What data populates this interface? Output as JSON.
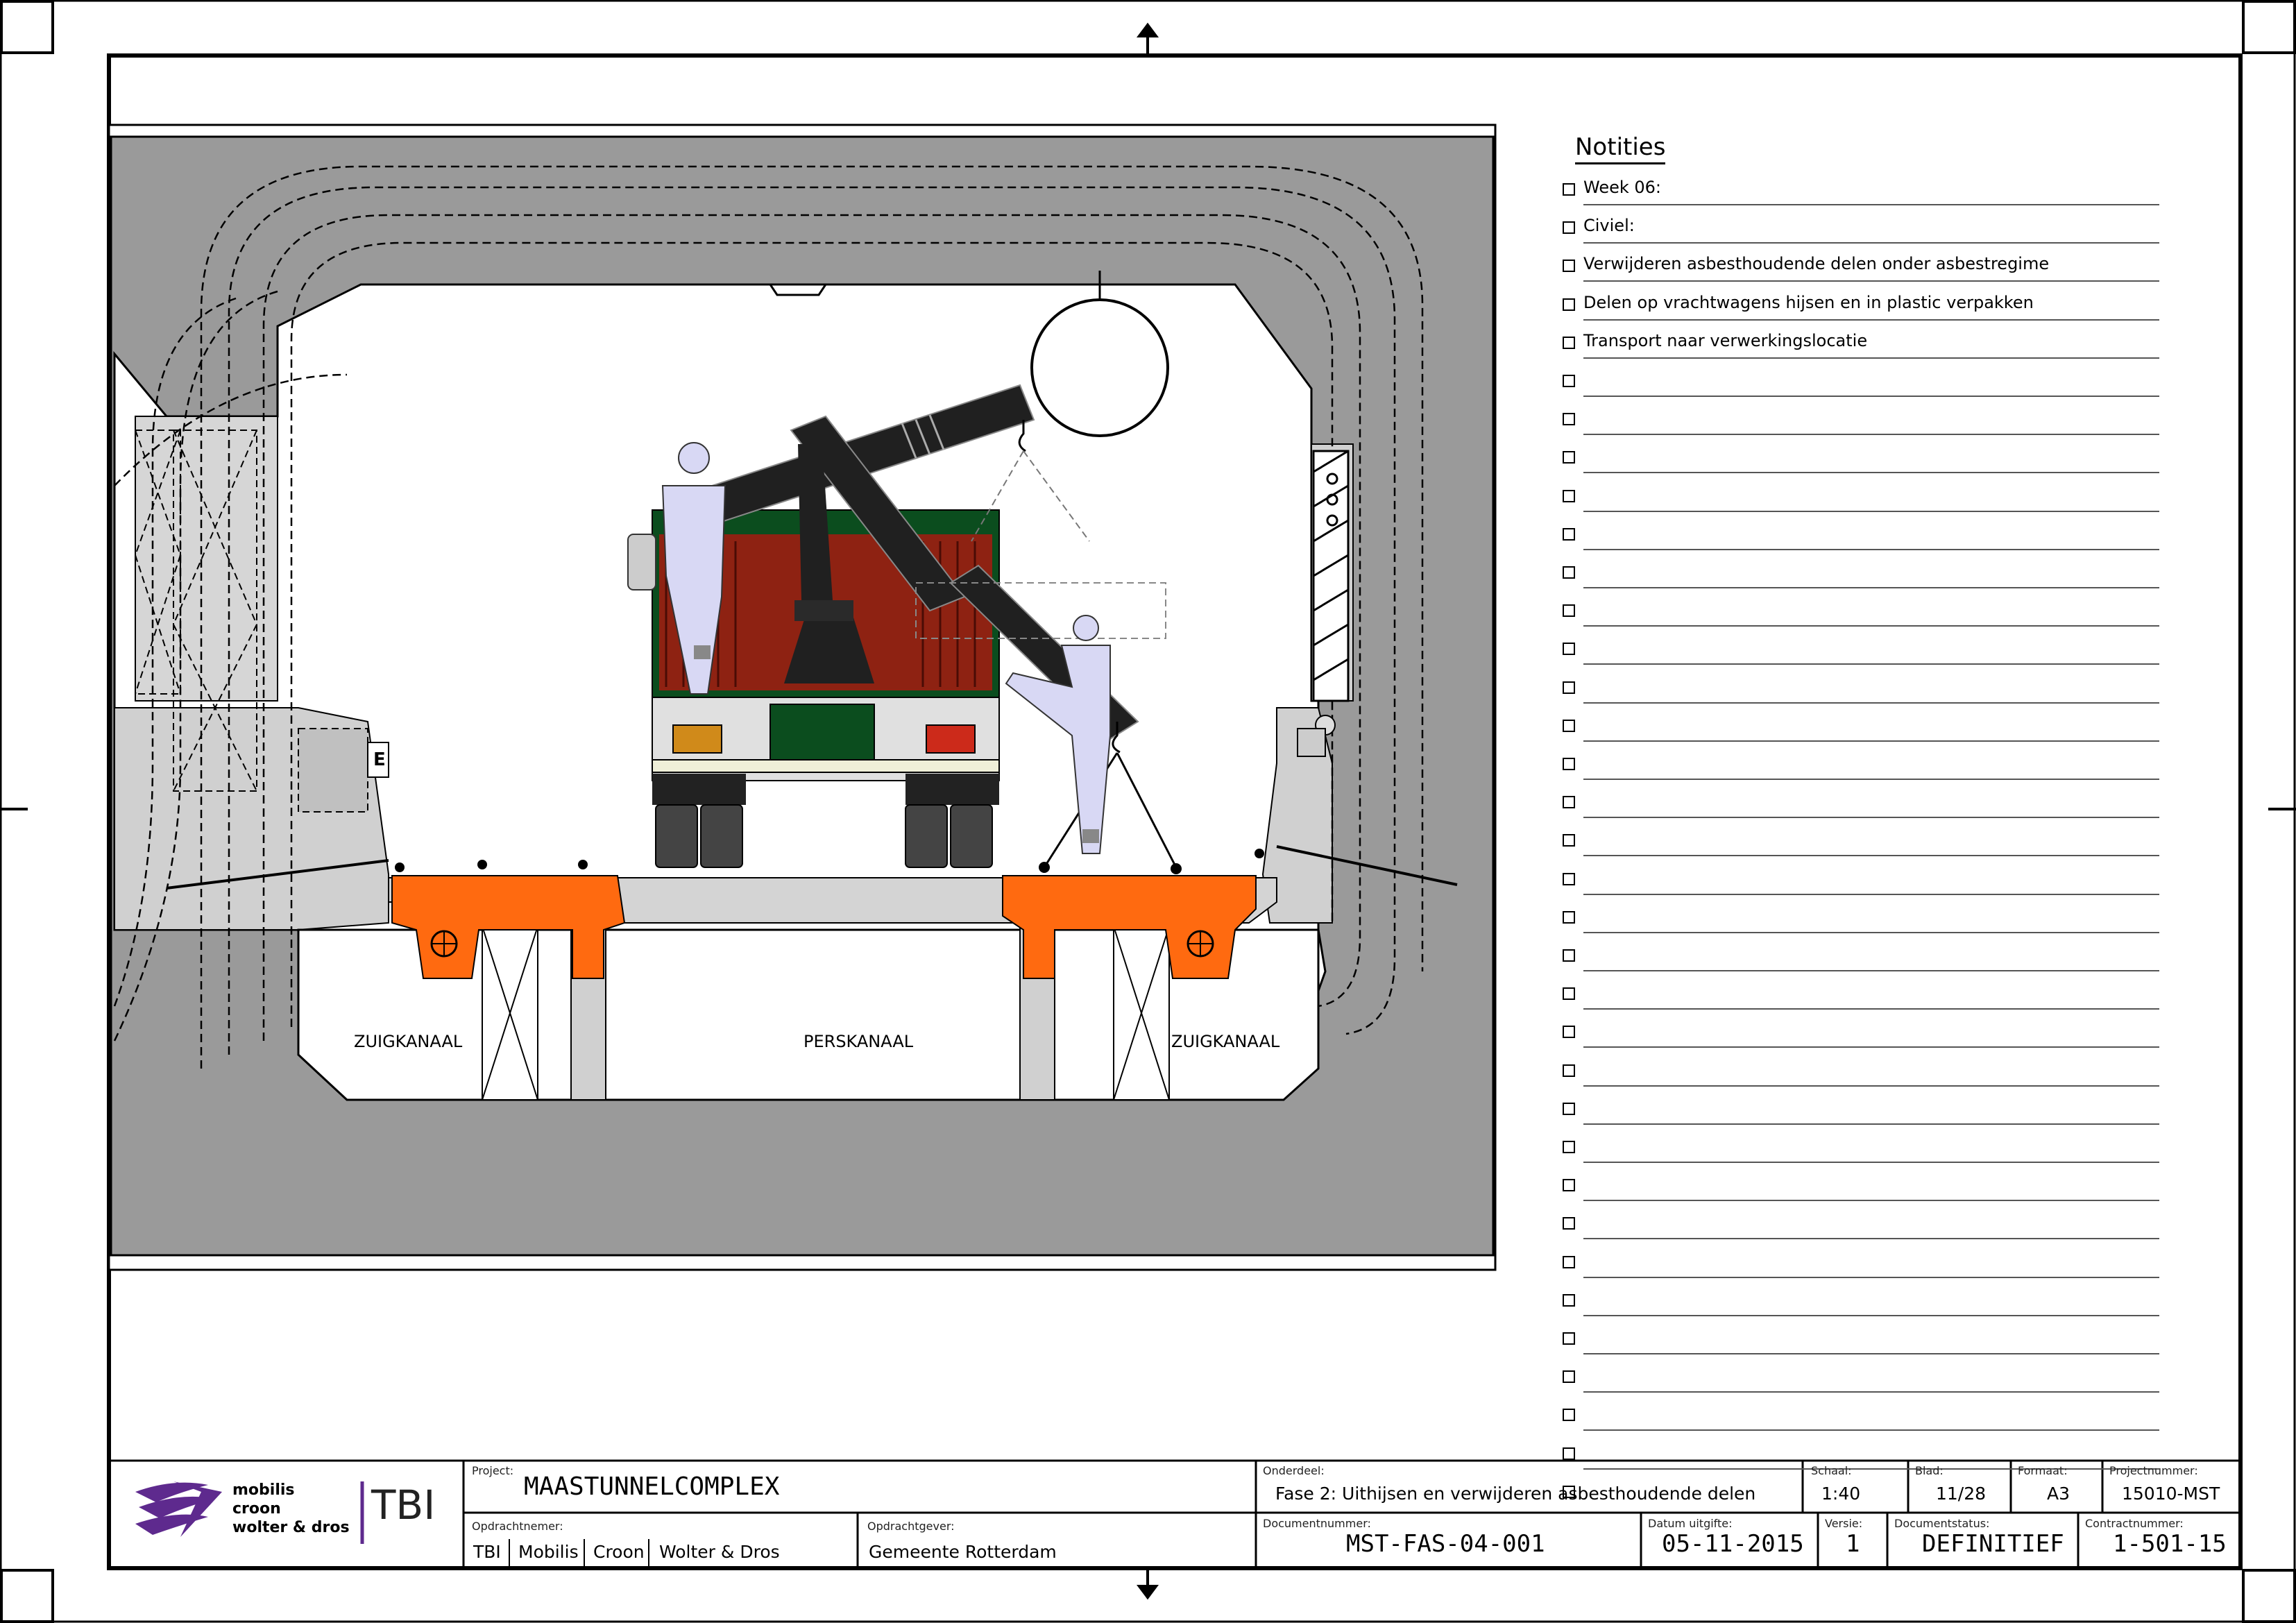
{
  "notes": {
    "title": "Notities",
    "items": [
      "Week 06:",
      "Civiel:",
      "Verwijderen asbesthoudende delen onder asbestregime",
      "Delen op vrachtwagens hijsen en in plastic verpakken",
      "Transport naar verwerkingslocatie"
    ],
    "empty_rows": 30
  },
  "drawing": {
    "labels": {
      "left_channel": "ZUIGKANAAL",
      "middle_channel": "PERSKANAAL",
      "right_channel": "ZUIGKANAAL",
      "box_marker": "E"
    },
    "colors": {
      "background_fill": "#9a9a9a",
      "light_concrete": "#cfcfcf",
      "asbestos_highlight": "#ff6a10",
      "truck_green": "#0b4d1e",
      "truck_cargo": "#8e2212",
      "crane_black": "#202020",
      "worker_suit": "#d8d8f4"
    }
  },
  "titleblock": {
    "logo": {
      "line1": "mobilis",
      "line2": "croon",
      "line3": "wolter & dros",
      "brand": "TBI",
      "wing_color": "#5e2a8e"
    },
    "project_label": "Project:",
    "project": "MAASTUNNELCOMPLEX",
    "onderdeel_label": "Onderdeel:",
    "onderdeel": "Fase 2: Uithijsen en verwijderen asbesthoudende delen",
    "schaal_label": "Schaal:",
    "schaal": "1:40",
    "blad_label": "Blad:",
    "blad": "11/28",
    "formaat_label": "Formaat:",
    "formaat": "A3",
    "projectnummer_label": "Projectnummer:",
    "projectnummer": "15010-MST",
    "opdrachtnemer_label": "Opdrachtnemer:",
    "opdrachtnemer": [
      "TBI",
      "Mobilis",
      "Croon",
      "Wolter & Dros"
    ],
    "opdrachtgever_label": "Opdrachtgever:",
    "opdrachtgever": "Gemeente Rotterdam",
    "documentnummer_label": "Documentnummer:",
    "documentnummer": "MST-FAS-04-001",
    "datum_label": "Datum uitgifte:",
    "datum": "05-11-2015",
    "versie_label": "Versie:",
    "versie": "1",
    "status_label": "Documentstatus:",
    "status": "DEFINITIEF",
    "contract_label": "Contractnummer:",
    "contract": "1-501-15"
  }
}
